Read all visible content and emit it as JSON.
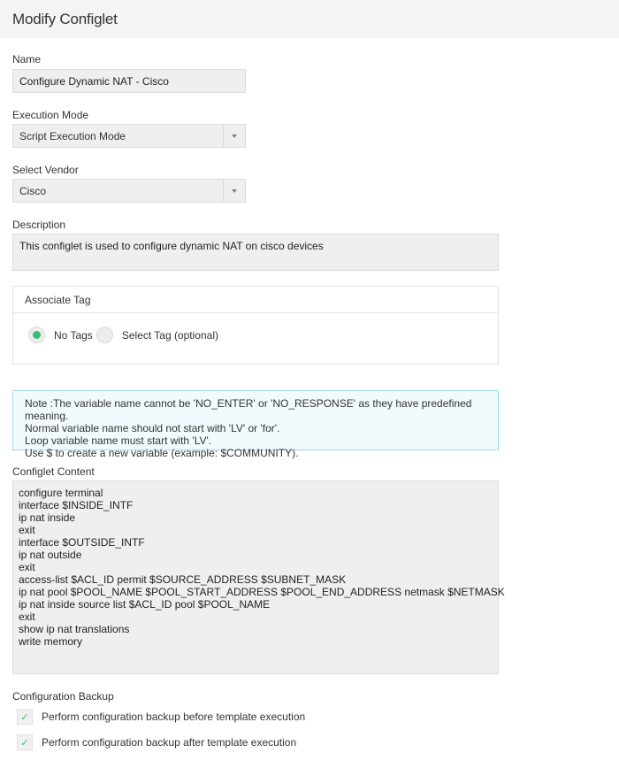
{
  "header": {
    "title": "Modify Configlet"
  },
  "name": {
    "label": "Name",
    "value": "Configure Dynamic NAT - Cisco"
  },
  "execution_mode": {
    "label": "Execution Mode",
    "selected": "Script Execution Mode"
  },
  "vendor": {
    "label": "Select Vendor",
    "selected": "Cisco"
  },
  "description": {
    "label": "Description",
    "value": "This configlet is used to configure dynamic NAT on cisco devices"
  },
  "associate_tag": {
    "title": "Associate Tag",
    "options": [
      {
        "label": "No Tags",
        "selected": true
      },
      {
        "label": "Select Tag (optional)",
        "selected": false
      }
    ]
  },
  "note": {
    "lines": [
      "Note :The variable name cannot be 'NO_ENTER' or 'NO_RESPONSE' as they have predefined meaning.",
      "Normal variable name should not start with 'LV' or 'for'.",
      "Loop variable name must start with 'LV'.",
      "Use $ to create a new variable (example: $COMMUNITY)."
    ]
  },
  "configlet_content": {
    "label": "Configlet Content",
    "lines": [
      "configure terminal",
      "interface $INSIDE_INTF",
      "ip nat inside",
      "exit",
      "interface $OUTSIDE_INTF",
      "ip nat outside",
      "exit",
      "access-list $ACL_ID permit $SOURCE_ADDRESS $SUBNET_MASK",
      "ip nat pool $POOL_NAME $POOL_START_ADDRESS $POOL_END_ADDRESS netmask $NETMASK",
      "ip nat inside source list $ACL_ID pool $POOL_NAME",
      "exit",
      "show ip nat translations",
      "write memory"
    ]
  },
  "backup": {
    "label": "Configuration Backup",
    "options": [
      {
        "label": "Perform configuration backup before template execution",
        "checked": true,
        "icon": "check-icon"
      },
      {
        "label": "Perform configuration backup after template execution",
        "checked": true,
        "icon": "check-icon"
      }
    ]
  },
  "colors": {
    "accent": "#3dbb73",
    "note_border": "#9fd6e9",
    "note_bg": "#f1fafd",
    "field_bg": "#efefef"
  }
}
